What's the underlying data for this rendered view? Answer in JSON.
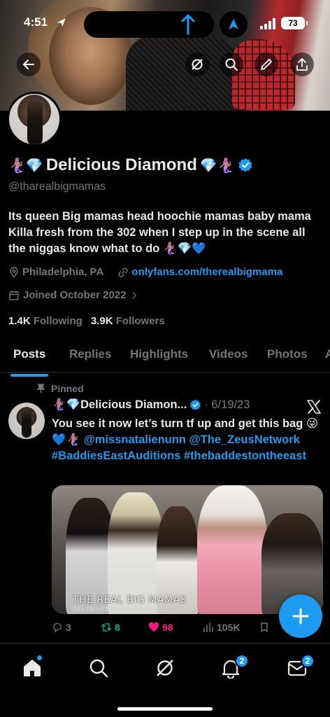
{
  "status_bar": {
    "time": "4:51",
    "battery": "73"
  },
  "profile": {
    "name_emoji_left": "🧜🏽‍♀️💎",
    "name": "Delicious Diamond",
    "name_emoji_right": "💎🧜🏽‍♀️",
    "handle": "@tharealbigmamas",
    "bio": "Its queen Big mamas head hoochie mamas baby mama Killa fresh from the 302 when I step up in the scene all the niggas know what to do 🧜🏽‍♀️💎💙",
    "location": "Philadelphia, PA",
    "link": "onlyfans.com/therealbigmama",
    "joined": "Joined October 2022",
    "following_count": "1.4K",
    "following_label": "Following",
    "followers_count": "3.9K",
    "followers_label": "Followers"
  },
  "tabs": [
    "Posts",
    "Replies",
    "Highlights",
    "Videos",
    "Photos",
    "A"
  ],
  "pinned_tweet": {
    "pinned_label": "Pinned",
    "name": "🧜🏽‍♀️💎Delicious Diamon...",
    "date": "· 6/19/23",
    "text_plain": "You see it now let’s turn tf up and get this bag 😜💙🧜🏽‍♀️",
    "mention1": "@missnatalienunn",
    "mention2": "@The_ZeusNetwork",
    "hashtag1": "#BaddiesEastAuditions",
    "hashtag2": "#thebaddestontheeast",
    "media_caption": "THE REAL BIG MAMAS",
    "media_subcaption": "DELAWARE",
    "replies": "3",
    "retweets": "8",
    "likes": "98",
    "views": "105K"
  },
  "bottom_nav": {
    "notifications_count": "2",
    "messages_count": "2"
  },
  "colors": {
    "accent": "#1d9bf0",
    "retweet": "#00ba7c",
    "like": "#f91880",
    "muted": "#71767b"
  }
}
